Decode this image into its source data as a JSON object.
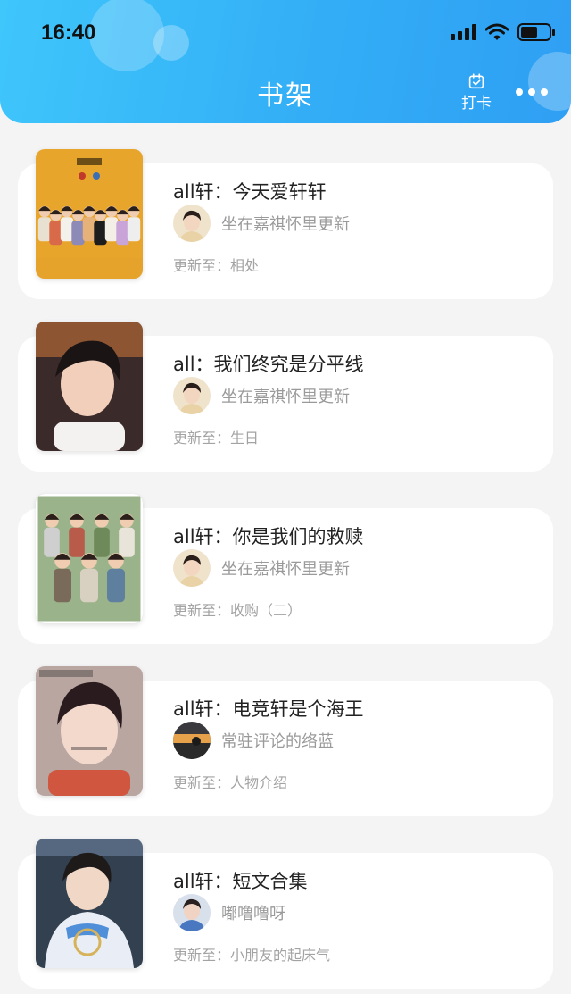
{
  "status_bar": {
    "time": "16:40"
  },
  "header": {
    "title": "书架",
    "checkin_label": "打卡",
    "accent_color": "#33aef6"
  },
  "books": [
    {
      "title": "all轩：今天爱轩轩",
      "author": "坐在嘉祺怀里更新",
      "update": "更新至：相处",
      "cover_theme": "yellow-group",
      "avatar_theme": "warm"
    },
    {
      "title": "all：我们终究是分平线",
      "author": "坐在嘉祺怀里更新",
      "update": "更新至：生日",
      "cover_theme": "portrait-dark",
      "avatar_theme": "warm"
    },
    {
      "title": "all轩：你是我们的救赎",
      "author": "坐在嘉祺怀里更新",
      "update": "更新至：收购（二）",
      "cover_theme": "green-group",
      "avatar_theme": "warm"
    },
    {
      "title": "all轩：电竞轩是个海王",
      "author": "常驻评论的络蓝",
      "update": "更新至：人物介绍",
      "cover_theme": "portrait-red",
      "avatar_theme": "sunset"
    },
    {
      "title": "all轩：短文合集",
      "author": "嘟噜噜呀",
      "update": "更新至：小朋友的起床气",
      "cover_theme": "portrait-blue",
      "avatar_theme": "blue"
    }
  ]
}
